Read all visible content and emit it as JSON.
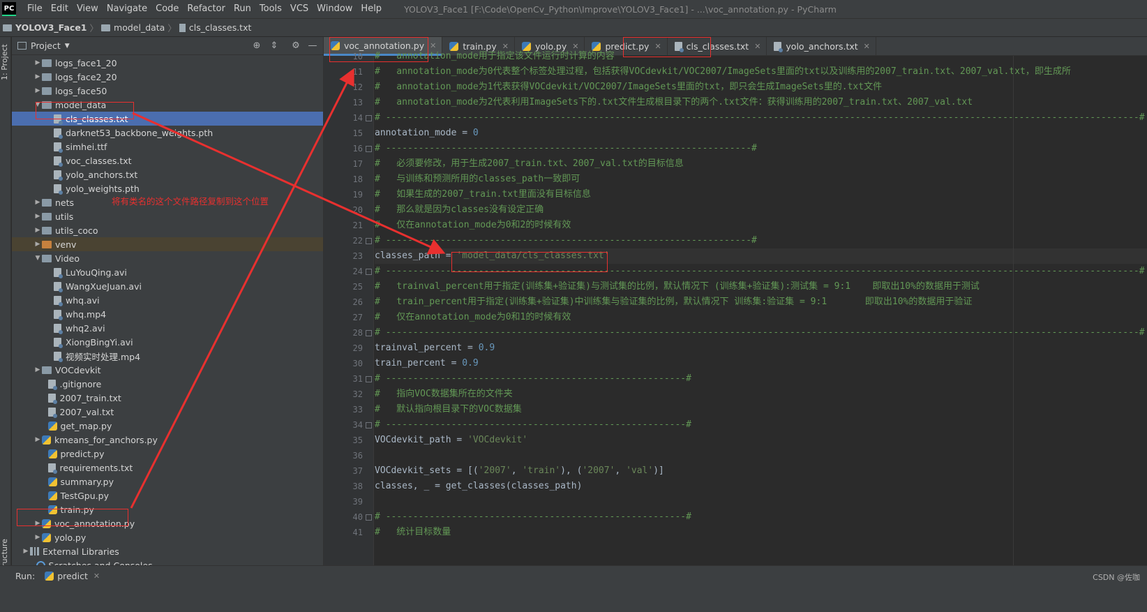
{
  "app": {
    "logo_text": "PC",
    "window_title": "YOLOV3_Face1 [F:\\Code\\OpenCv_Python\\Improve\\YOLOV3_Face1] - ...\\voc_annotation.py - PyCharm"
  },
  "menu": [
    "File",
    "Edit",
    "View",
    "Navigate",
    "Code",
    "Refactor",
    "Run",
    "Tools",
    "VCS",
    "Window",
    "Help"
  ],
  "breadcrumb": [
    "YOLOV3_Face1",
    "model_data",
    "cls_classes.txt"
  ],
  "left_strip": {
    "project_tab": "1: Project",
    "structure_tab": "Z: Structure"
  },
  "project_panel": {
    "title": "Project",
    "tree": [
      {
        "label": "logs_face1_20",
        "kind": "folder",
        "arrow": "▶",
        "indent": 0
      },
      {
        "label": "logs_face2_20",
        "kind": "folder",
        "arrow": "▶",
        "indent": 0
      },
      {
        "label": "logs_face50",
        "kind": "folder",
        "arrow": "▶",
        "indent": 0
      },
      {
        "label": "model_data",
        "kind": "folder",
        "arrow": "▼",
        "indent": 0
      },
      {
        "label": "cls_classes.txt",
        "kind": "file",
        "arrow": "",
        "indent": 1,
        "selected": true
      },
      {
        "label": "darknet53_backbone_weights.pth",
        "kind": "file",
        "arrow": "",
        "indent": 1
      },
      {
        "label": "simhei.ttf",
        "kind": "file",
        "arrow": "",
        "indent": 1
      },
      {
        "label": "voc_classes.txt",
        "kind": "file",
        "arrow": "",
        "indent": 1
      },
      {
        "label": "yolo_anchors.txt",
        "kind": "file",
        "arrow": "",
        "indent": 1
      },
      {
        "label": "yolo_weights.pth",
        "kind": "file",
        "arrow": "",
        "indent": 1
      },
      {
        "label": "nets",
        "kind": "folder",
        "arrow": "▶",
        "indent": 0
      },
      {
        "label": "utils",
        "kind": "folder",
        "arrow": "▶",
        "indent": 0
      },
      {
        "label": "utils_coco",
        "kind": "folder",
        "arrow": "▶",
        "indent": 0
      },
      {
        "label": "venv",
        "kind": "folder-orange",
        "arrow": "▶",
        "indent": 0,
        "venv": true
      },
      {
        "label": "Video",
        "kind": "folder",
        "arrow": "▼",
        "indent": 0
      },
      {
        "label": "LuYouQing.avi",
        "kind": "file",
        "arrow": "",
        "indent": 1
      },
      {
        "label": "WangXueJuan.avi",
        "kind": "file",
        "arrow": "",
        "indent": 1
      },
      {
        "label": "whq.avi",
        "kind": "file",
        "arrow": "",
        "indent": 1
      },
      {
        "label": "whq.mp4",
        "kind": "file",
        "arrow": "",
        "indent": 1
      },
      {
        "label": "whq2.avi",
        "kind": "file",
        "arrow": "",
        "indent": 1
      },
      {
        "label": "XiongBingYi.avi",
        "kind": "file",
        "arrow": "",
        "indent": 1
      },
      {
        "label": "视频实时处理.mp4",
        "kind": "file",
        "arrow": "",
        "indent": 1
      },
      {
        "label": "VOCdevkit",
        "kind": "folder",
        "arrow": "▶",
        "indent": 0
      },
      {
        "label": ".gitignore",
        "kind": "file",
        "arrow": "",
        "indent": 0.5
      },
      {
        "label": "2007_train.txt",
        "kind": "file",
        "arrow": "",
        "indent": 0.5
      },
      {
        "label": "2007_val.txt",
        "kind": "file",
        "arrow": "",
        "indent": 0.5
      },
      {
        "label": "get_map.py",
        "kind": "py",
        "arrow": "",
        "indent": 0.5
      },
      {
        "label": "kmeans_for_anchors.py",
        "kind": "py",
        "arrow": "▶",
        "indent": 0
      },
      {
        "label": "predict.py",
        "kind": "py",
        "arrow": "",
        "indent": 0.5
      },
      {
        "label": "requirements.txt",
        "kind": "file",
        "arrow": "",
        "indent": 0.5
      },
      {
        "label": "summary.py",
        "kind": "py",
        "arrow": "",
        "indent": 0.5
      },
      {
        "label": "TestGpu.py",
        "kind": "py",
        "arrow": "",
        "indent": 0.5
      },
      {
        "label": "train.py",
        "kind": "py",
        "arrow": "",
        "indent": 0.5
      },
      {
        "label": "voc_annotation.py",
        "kind": "py",
        "arrow": "▶",
        "indent": 0
      },
      {
        "label": "yolo.py",
        "kind": "py",
        "arrow": "▶",
        "indent": 0
      },
      {
        "label": "External Libraries",
        "kind": "lib",
        "arrow": "▶",
        "indent": -1
      },
      {
        "label": "Scratches and Consoles",
        "kind": "scratch",
        "arrow": "",
        "indent": -0.5
      }
    ]
  },
  "tabs": [
    {
      "label": "voc_annotation.py",
      "kind": "py",
      "active": true
    },
    {
      "label": "train.py",
      "kind": "py"
    },
    {
      "label": "yolo.py",
      "kind": "py"
    },
    {
      "label": "predict.py",
      "kind": "py"
    },
    {
      "label": "cls_classes.txt",
      "kind": "file"
    },
    {
      "label": "yolo_anchors.txt",
      "kind": "file"
    }
  ],
  "code": [
    {
      "n": "10",
      "segs": [
        [
          "comment",
          "#   annotation_mode用于指定该文件运行时计算的内容"
        ]
      ]
    },
    {
      "n": "11",
      "segs": [
        [
          "comment",
          "#   annotation_mode为0代表整个标签处理过程，包括获得VOCdevkit/VOC2007/ImageSets里面的txt以及训练用的2007_train.txt、2007_val.txt，即生成所"
        ]
      ]
    },
    {
      "n": "12",
      "segs": [
        [
          "comment",
          "#   annotation_mode为1代表获得VOCdevkit/VOC2007/ImageSets里面的txt，即只会生成ImageSets里的.txt文件"
        ]
      ]
    },
    {
      "n": "13",
      "segs": [
        [
          "comment",
          "#   annotation_mode为2代表利用ImageSets下的.txt文件生成根目录下的两个.txt文件：获得训练用的2007_train.txt、2007_val.txt"
        ]
      ]
    },
    {
      "n": "14",
      "fold": true,
      "segs": [
        [
          "comment",
          "# ------------------------------------------------------------------------------------------------------------------------------------------#"
        ]
      ]
    },
    {
      "n": "15",
      "segs": [
        [
          "plain",
          "annotation_mode = "
        ],
        [
          "num",
          "0"
        ]
      ]
    },
    {
      "n": "16",
      "fold": true,
      "segs": [
        [
          "comment",
          "# -------------------------------------------------------------------#"
        ]
      ]
    },
    {
      "n": "17",
      "segs": [
        [
          "comment",
          "#   必须要修改，用于生成2007_train.txt、2007_val.txt的目标信息"
        ]
      ]
    },
    {
      "n": "18",
      "segs": [
        [
          "comment",
          "#   与训练和预测所用的classes_path一致即可"
        ]
      ]
    },
    {
      "n": "19",
      "segs": [
        [
          "comment",
          "#   如果生成的2007_train.txt里面没有目标信息"
        ]
      ]
    },
    {
      "n": "20",
      "segs": [
        [
          "comment",
          "#   那么就是因为classes没有设定正确"
        ]
      ]
    },
    {
      "n": "21",
      "segs": [
        [
          "comment",
          "#   仅在annotation_mode为0和2的时候有效"
        ]
      ]
    },
    {
      "n": "22",
      "fold": true,
      "segs": [
        [
          "comment",
          "# -------------------------------------------------------------------#"
        ]
      ]
    },
    {
      "n": "23",
      "current": true,
      "segs": [
        [
          "plain",
          "classes_path = "
        ],
        [
          "str",
          "'model_data/cls_classes.txt'"
        ]
      ]
    },
    {
      "n": "24",
      "fold": true,
      "segs": [
        [
          "comment",
          "# ------------------------------------------------------------------------------------------------------------------------------------------#"
        ]
      ]
    },
    {
      "n": "25",
      "segs": [
        [
          "comment",
          "#   trainval_percent用于指定(训练集+验证集)与测试集的比例，默认情况下 (训练集+验证集):测试集 = 9:1    即取出10%的数据用于测试"
        ]
      ]
    },
    {
      "n": "26",
      "segs": [
        [
          "comment",
          "#   train_percent用于指定(训练集+验证集)中训练集与验证集的比例，默认情况下 训练集:验证集 = 9:1       即取出10%的数据用于验证"
        ]
      ]
    },
    {
      "n": "27",
      "segs": [
        [
          "comment",
          "#   仅在annotation_mode为0和1的时候有效"
        ]
      ]
    },
    {
      "n": "28",
      "fold": true,
      "segs": [
        [
          "comment",
          "# ------------------------------------------------------------------------------------------------------------------------------------------#"
        ]
      ]
    },
    {
      "n": "29",
      "segs": [
        [
          "plain",
          "trainval_percent = "
        ],
        [
          "num",
          "0.9"
        ]
      ]
    },
    {
      "n": "30",
      "segs": [
        [
          "plain",
          "train_percent = "
        ],
        [
          "num",
          "0.9"
        ]
      ]
    },
    {
      "n": "31",
      "fold": true,
      "segs": [
        [
          "comment",
          "# -------------------------------------------------------#"
        ]
      ]
    },
    {
      "n": "32",
      "segs": [
        [
          "comment",
          "#   指向VOC数据集所在的文件夹"
        ]
      ]
    },
    {
      "n": "33",
      "segs": [
        [
          "comment",
          "#   默认指向根目录下的VOC数据集"
        ]
      ]
    },
    {
      "n": "34",
      "fold": true,
      "segs": [
        [
          "comment",
          "# -------------------------------------------------------#"
        ]
      ]
    },
    {
      "n": "35",
      "segs": [
        [
          "plain",
          "VOCdevkit_path = "
        ],
        [
          "str",
          "'VOCdevkit'"
        ]
      ]
    },
    {
      "n": "36",
      "segs": [
        [
          "plain",
          ""
        ]
      ]
    },
    {
      "n": "37",
      "segs": [
        [
          "plain",
          "VOCdevkit_sets = [("
        ],
        [
          "str",
          "'2007'"
        ],
        [
          "plain",
          ", "
        ],
        [
          "str",
          "'train'"
        ],
        [
          "plain",
          "), ("
        ],
        [
          "str",
          "'2007'"
        ],
        [
          "plain",
          ", "
        ],
        [
          "str",
          "'val'"
        ],
        [
          "plain",
          ")]"
        ]
      ]
    },
    {
      "n": "38",
      "segs": [
        [
          "plain",
          "classes, _ = get_classes(classes_path)"
        ]
      ]
    },
    {
      "n": "39",
      "segs": [
        [
          "plain",
          ""
        ]
      ]
    },
    {
      "n": "40",
      "fold": true,
      "segs": [
        [
          "comment",
          "# -------------------------------------------------------#"
        ]
      ]
    },
    {
      "n": "41",
      "segs": [
        [
          "comment",
          "#   统计目标数量"
        ]
      ]
    }
  ],
  "annotation": {
    "text": "将有类名的这个文件路径复制到这个位置",
    "color": "#e8302f"
  },
  "statusbar": {
    "run_label": "Run:",
    "run_tab": "predict",
    "watermark": "CSDN @佐咖"
  },
  "colors": {
    "accent": "#4a88c7",
    "selection": "#4b6eaf",
    "comment": "#629755",
    "string": "#6a8759",
    "number": "#6897bb"
  }
}
